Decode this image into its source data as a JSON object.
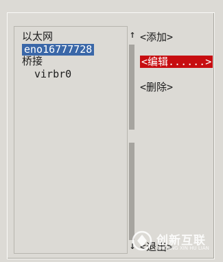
{
  "device_list": {
    "groups": [
      {
        "label": "以太网",
        "devices": [
          "eno16777728"
        ]
      },
      {
        "label": "桥接",
        "devices": [
          "virbr0"
        ]
      }
    ],
    "selected_device": "eno16777728"
  },
  "scrollbar": {
    "up_arrow": "↑",
    "down_arrow": "↓"
  },
  "actions": {
    "add": "<添加>",
    "edit": "<编辑......>",
    "delete": "<删除>",
    "quit": "<退出>"
  },
  "watermark": {
    "brand": "创新互联",
    "sub": "CHUANG XIN HU LIAN"
  },
  "colors": {
    "background": "#dcdad5",
    "selection": "#3a67a8",
    "focused_button": "#c70d10"
  }
}
